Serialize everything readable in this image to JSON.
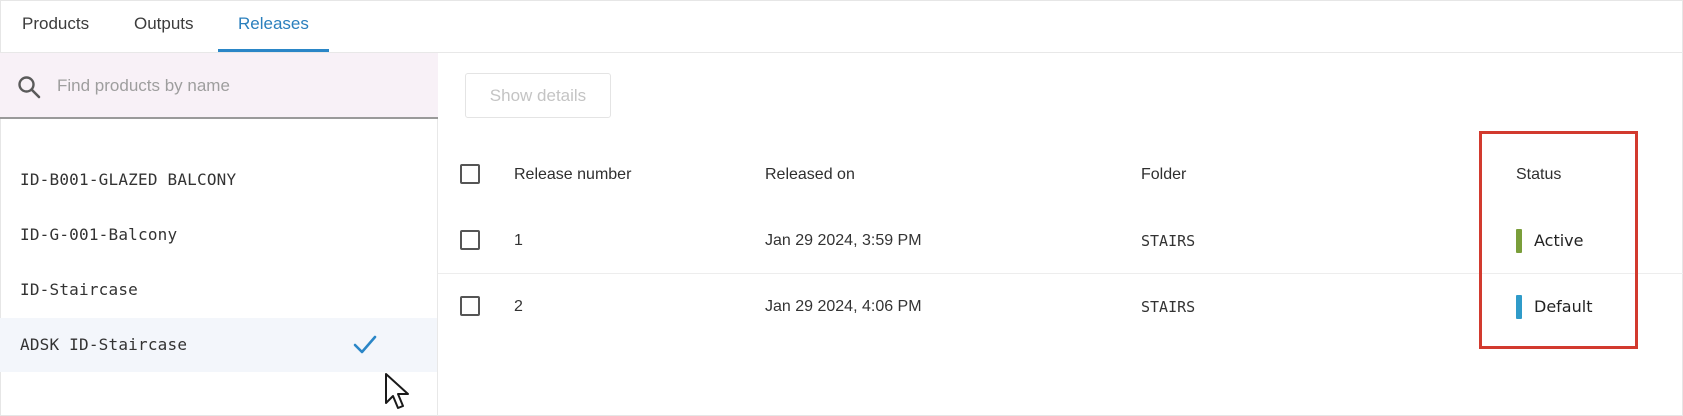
{
  "tabs": [
    {
      "label": "Products",
      "active": false
    },
    {
      "label": "Outputs",
      "active": false
    },
    {
      "label": "Releases",
      "active": true
    }
  ],
  "search": {
    "placeholder": "Find products by name",
    "value": ""
  },
  "products": [
    {
      "name": "ID-B001-GLAZED BALCONY",
      "selected": false
    },
    {
      "name": "ID-G-001-Balcony",
      "selected": false
    },
    {
      "name": "ID-Staircase",
      "selected": false
    },
    {
      "name": "ADSK ID-Staircase",
      "selected": true
    }
  ],
  "toolbar": {
    "show_details_label": "Show details"
  },
  "table": {
    "headers": {
      "release_number": "Release number",
      "released_on": "Released on",
      "folder": "Folder",
      "status": "Status"
    },
    "rows": [
      {
        "release_number": "1",
        "released_on": "Jan 29 2024, 3:59 PM",
        "folder": "STAIRS",
        "status": "Active",
        "status_color": "#7a9e3a"
      },
      {
        "release_number": "2",
        "released_on": "Jan 29 2024, 4:06 PM",
        "folder": "STAIRS",
        "status": "Default",
        "status_color": "#2f9bc9"
      }
    ]
  },
  "colors": {
    "accent": "#2a86c7",
    "highlight": "#d23a2e",
    "selected_bg": "#f3f6fb",
    "search_bg": "#f8f1f7"
  }
}
